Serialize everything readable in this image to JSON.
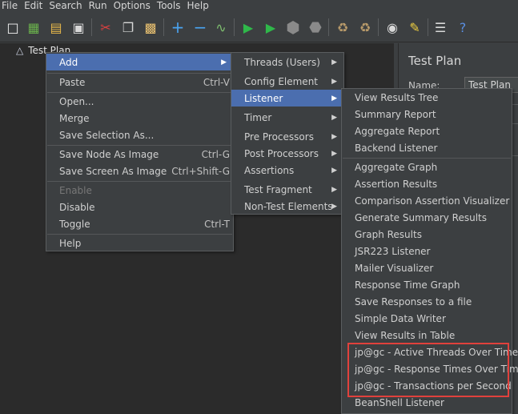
{
  "menubar": {
    "items": [
      "File",
      "Edit",
      "Search",
      "Run",
      "Options",
      "Tools",
      "Help"
    ]
  },
  "toolbar": {
    "icons": [
      "new-icon",
      "templates-icon",
      "open-icon",
      "save-icon",
      "cut-icon",
      "copy-icon",
      "paste-icon",
      "expand-icon",
      "collapse-icon",
      "toggle-icon",
      "start-icon",
      "start-no-pause-icon",
      "stop-icon",
      "shutdown-icon",
      "clear-icon",
      "clear-all-icon",
      "search-icon",
      "reset-search-icon",
      "function-helper-icon",
      "help-icon"
    ]
  },
  "tree": {
    "root_label": "Test Plan"
  },
  "right_panel": {
    "title": "Test Plan",
    "name_label": "Name:",
    "name_value": "Test Plan"
  },
  "context_menu": {
    "items": [
      {
        "label": "Add",
        "shortcut": "",
        "submenu": true
      },
      {
        "label": "Paste",
        "shortcut": "Ctrl-V"
      },
      {
        "label": "Open...",
        "shortcut": ""
      },
      {
        "label": "Merge",
        "shortcut": ""
      },
      {
        "label": "Save Selection As...",
        "shortcut": ""
      },
      {
        "label": "Save Node As Image",
        "shortcut": "Ctrl-G"
      },
      {
        "label": "Save Screen As Image",
        "shortcut": "Ctrl+Shift-G"
      },
      {
        "label": "Enable",
        "shortcut": ""
      },
      {
        "label": "Disable",
        "shortcut": ""
      },
      {
        "label": "Toggle",
        "shortcut": "Ctrl-T"
      },
      {
        "label": "Help",
        "shortcut": ""
      }
    ]
  },
  "add_submenu": {
    "items": [
      "Threads (Users)",
      "Config Element",
      "Listener",
      "Timer",
      "Pre Processors",
      "Post Processors",
      "Assertions",
      "Test Fragment",
      "Non-Test Elements"
    ]
  },
  "listener_submenu": {
    "items": [
      "View Results Tree",
      "Summary Report",
      "Aggregate Report",
      "Backend Listener",
      "Aggregate Graph",
      "Assertion Results",
      "Comparison Assertion Visualizer",
      "Generate Summary Results",
      "Graph Results",
      "JSR223 Listener",
      "Mailer Visualizer",
      "Response Time Graph",
      "Save Responses to a file",
      "Simple Data Writer",
      "View Results in Table",
      "jp@gc - Active Threads Over Time",
      "jp@gc - Response Times Over Time",
      "jp@gc - Transactions per Second",
      "BeanShell Listener"
    ]
  },
  "colors": {
    "selected": "#4b6eaf",
    "highlight_border": "#e0413c",
    "background": "#3c3f41",
    "tree_bg": "#2b2b2b"
  }
}
